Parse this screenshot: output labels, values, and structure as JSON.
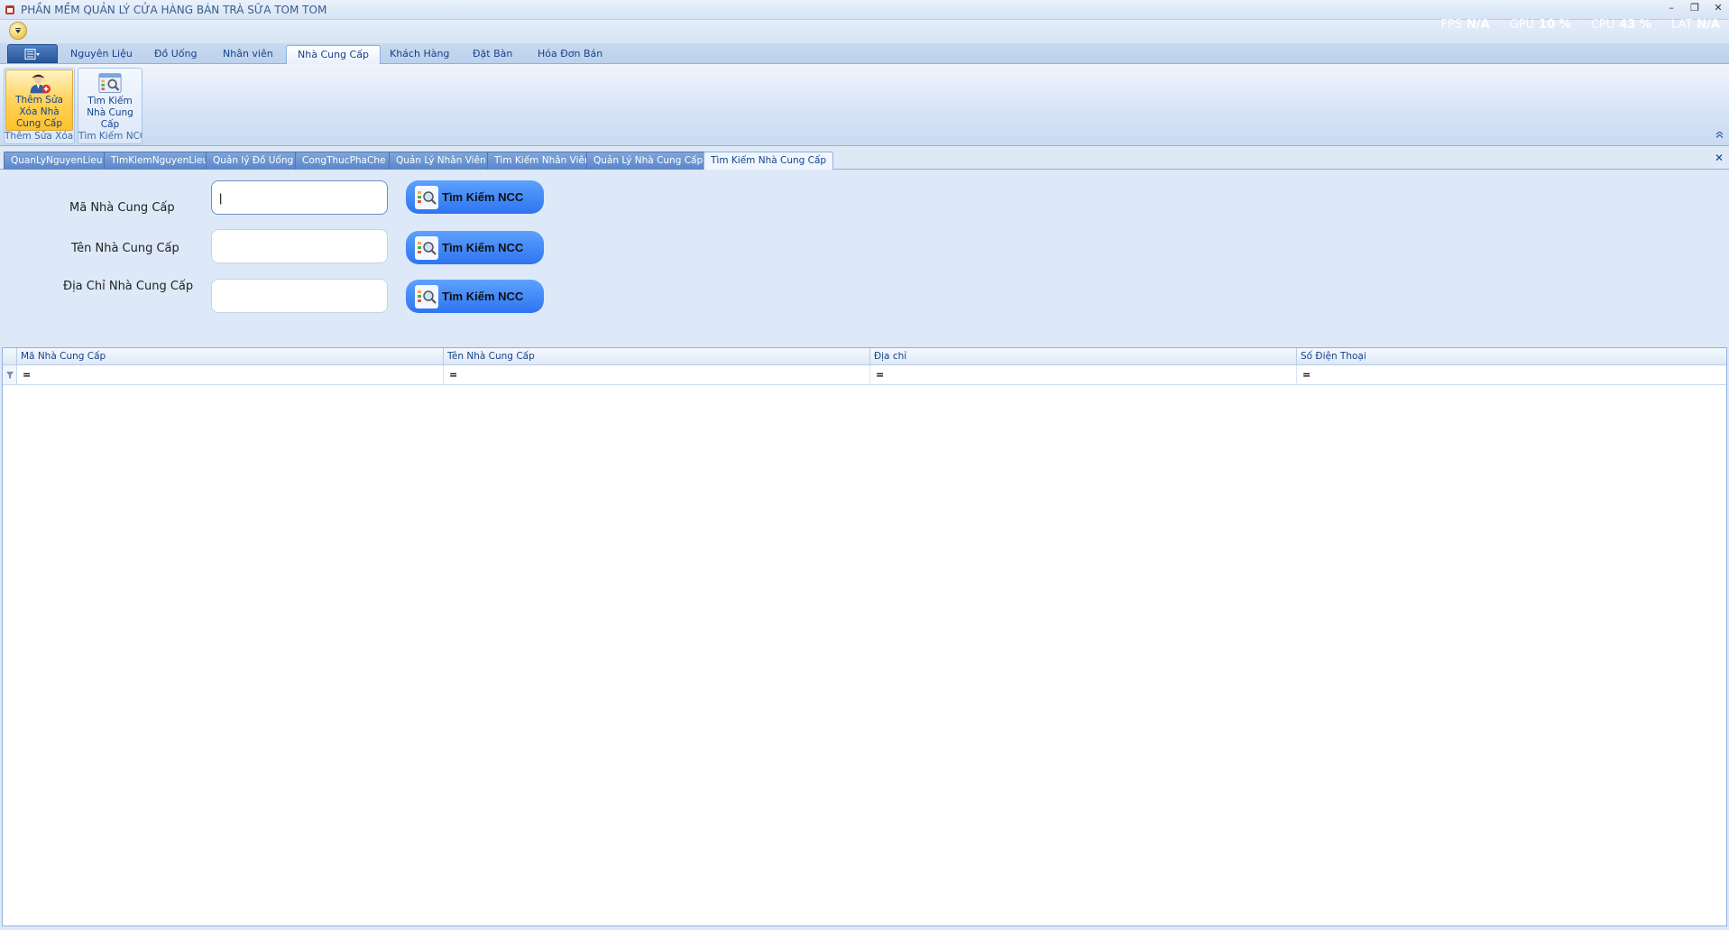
{
  "window": {
    "title": "PHẦN MỀM QUẢN LÝ CỬA HÀNG BÁN TRÀ SỮA TOM TOM",
    "controls": {
      "minimize": "–",
      "restore": "❐",
      "close": "✕"
    }
  },
  "perf": {
    "fps_label": "FPS",
    "fps_value": "N/A",
    "gpu_label": "GPU",
    "gpu_value": "10 %",
    "cpu_label": "CPU",
    "cpu_value": "43 %",
    "lat_label": "LAT",
    "lat_value": "N/A"
  },
  "ribbon": {
    "tabs": [
      "Nguyên Liệu",
      "Đồ Uống",
      "Nhân viên",
      "Nhà Cung Cấp",
      "Khách Hàng",
      "Đặt Bàn",
      "Hóa Đơn Bán"
    ],
    "active_tab": "Nhà Cung Cấp",
    "groups": [
      {
        "button_label": "Thêm Sửa Xóa Nhà Cung Cấp",
        "caption": "Thêm Sửa Xóa..."
      },
      {
        "button_label": "Tìm Kiếm Nhà Cung Cấp",
        "caption": "Tìm Kiếm NCC"
      }
    ]
  },
  "doc_tabs": [
    "QuanLyNguyenLieu",
    "TimKiemNguyenLieu",
    "Quản lý Đồ Uống",
    "CongThucPhaChe",
    "Quản Lý Nhân Viên",
    "Tìm Kiếm Nhân Viên",
    "Quản Lý Nhà Cung Cấp",
    "Tìm Kiếm Nhà Cung Cấp"
  ],
  "active_doc_tab": "Tìm Kiếm Nhà Cung Cấp",
  "search": {
    "fields": [
      {
        "label": "Mã Nhà Cung Cấp",
        "value": "|"
      },
      {
        "label": "Tên Nhà Cung Cấp",
        "value": ""
      },
      {
        "label": "Địa Chỉ Nhà Cung Cấp",
        "value": ""
      }
    ],
    "button_label": "Tìm Kiếm NCC"
  },
  "grid": {
    "columns": [
      "Mã Nhà Cung Cấp",
      "Tên Nhà Cung Cấp",
      "Địa chỉ",
      "Số Điện Thoại"
    ],
    "filter_symbol": "="
  },
  "colors": {
    "accent": "#2e74f0",
    "ribbon_border": "#8db2e3",
    "text": "#15428b"
  }
}
